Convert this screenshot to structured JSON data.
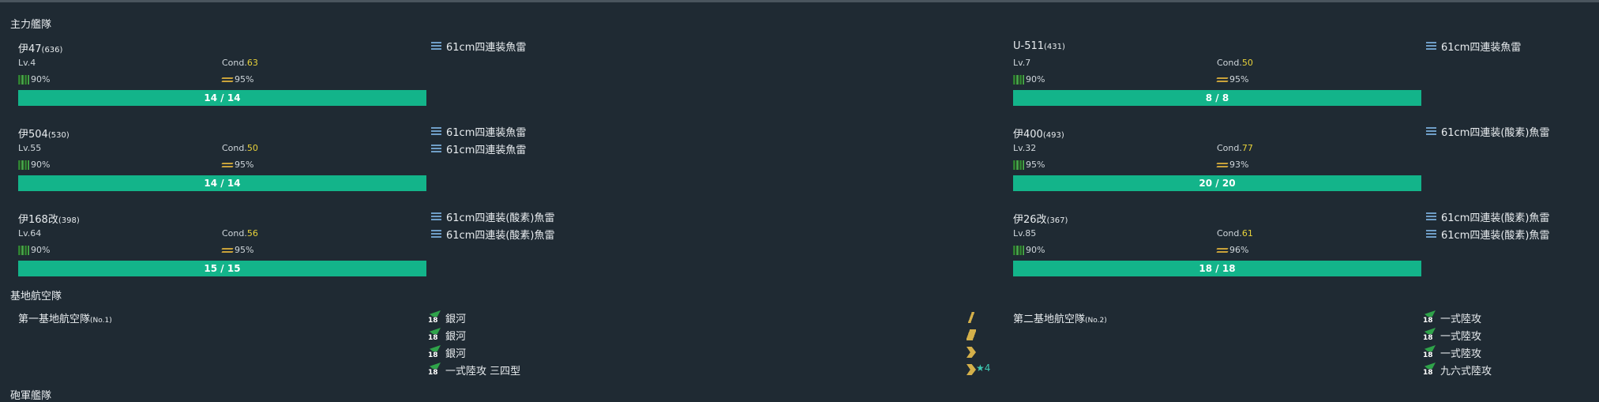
{
  "fleet_title": "主力艦隊",
  "ships": [
    {
      "name": "伊47",
      "id": "(636)",
      "lv": "Lv.4",
      "cond_label": "Cond.",
      "cond": "63",
      "fuel": "90%",
      "ammo": "95%",
      "hp": "14 / 14",
      "equip": [
        "61cm四連装魚雷"
      ]
    },
    {
      "name": "U-511",
      "id": "(431)",
      "lv": "Lv.7",
      "cond_label": "Cond.",
      "cond": "50",
      "fuel": "90%",
      "ammo": "95%",
      "hp": "8 / 8",
      "equip": [
        "61cm四連装魚雷"
      ]
    },
    {
      "name": "伊504",
      "id": "(530)",
      "lv": "Lv.55",
      "cond_label": "Cond.",
      "cond": "50",
      "fuel": "90%",
      "ammo": "95%",
      "hp": "14 / 14",
      "equip": [
        "61cm四連装魚雷",
        "61cm四連装魚雷"
      ]
    },
    {
      "name": "伊400",
      "id": "(493)",
      "lv": "Lv.32",
      "cond_label": "Cond.",
      "cond": "77",
      "fuel": "95%",
      "ammo": "93%",
      "hp": "20 / 20",
      "equip": [
        "61cm四連装(酸素)魚雷"
      ]
    },
    {
      "name": "伊168改",
      "id": "(398)",
      "lv": "Lv.64",
      "cond_label": "Cond.",
      "cond": "56",
      "fuel": "90%",
      "ammo": "95%",
      "hp": "15 / 15",
      "equip": [
        "61cm四連装(酸素)魚雷",
        "61cm四連装(酸素)魚雷"
      ]
    },
    {
      "name": "伊26改",
      "id": "(367)",
      "lv": "Lv.85",
      "cond_label": "Cond.",
      "cond": "61",
      "fuel": "90%",
      "ammo": "96%",
      "hp": "18 / 18",
      "equip": [
        "61cm四連装(酸素)魚雷",
        "61cm四連装(酸素)魚雷"
      ]
    }
  ],
  "air_title": "基地航空隊",
  "bases": [
    {
      "name": "第一基地航空隊",
      "no": "(No.1)",
      "planes": [
        {
          "count": "18",
          "name": "銀河"
        },
        {
          "count": "18",
          "name": "銀河"
        },
        {
          "count": "18",
          "name": "銀河"
        },
        {
          "count": "18",
          "name": "一式陸攻 三四型"
        }
      ],
      "proficiency": [
        "bar1",
        "bar2",
        "chev",
        "chev"
      ],
      "star": "★4"
    },
    {
      "name": "第二基地航空隊",
      "no": "(No.2)",
      "planes": [
        {
          "count": "18",
          "name": "一式陸攻"
        },
        {
          "count": "18",
          "name": "一式陸攻"
        },
        {
          "count": "18",
          "name": "一式陸攻"
        },
        {
          "count": "18",
          "name": "九六式陸攻"
        }
      ]
    }
  ],
  "next_title": "砲軍艦隊"
}
